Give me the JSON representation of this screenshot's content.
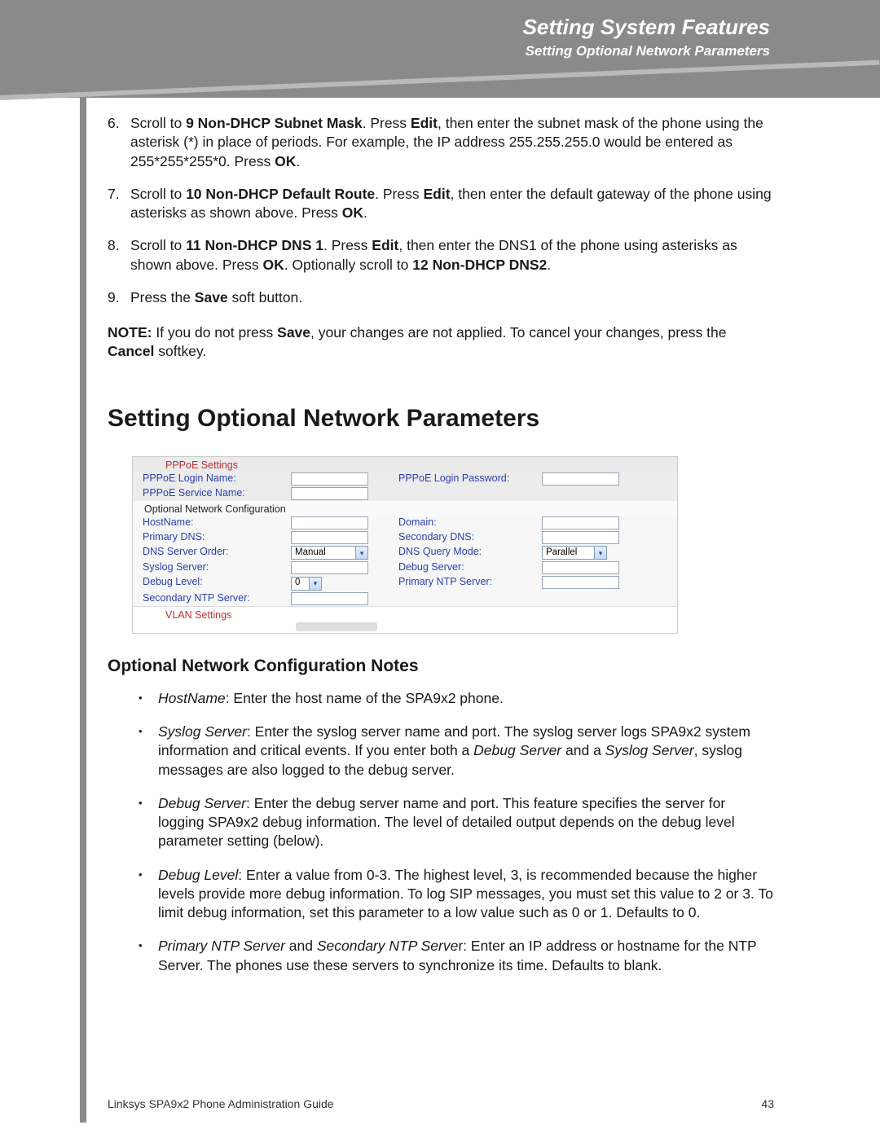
{
  "header": {
    "title": "Setting System Features",
    "subtitle": "Setting Optional Network Parameters"
  },
  "steps": [
    {
      "num": "6.",
      "html": "Scroll to <b>9 Non-DHCP Subnet Mask</b>. Press <b>Edit</b>, then enter the subnet mask of the phone using the asterisk (*) in place of periods. For example, the IP address 255.255.255.0 would be entered as 255*255*255*0. Press <b>OK</b>."
    },
    {
      "num": "7.",
      "html": "Scroll to <b>10 Non-DHCP Default Route</b>. Press <b>Edit</b>, then enter the default gateway of the phone using asterisks as shown above. Press <b>OK</b>."
    },
    {
      "num": "8.",
      "html": "Scroll to <b>11 Non-DHCP DNS 1</b>. Press <b>Edit</b>, then enter the DNS1 of the phone using asterisks as shown above. Press <b>OK</b>. Optionally scroll to <b>12 Non-DHCP DNS2</b>."
    },
    {
      "num": "9.",
      "html": "Press the <b>Save</b> soft button."
    }
  ],
  "note_html": "<b>NOTE:</b> If you do not press <b>Save</b>, your changes are not applied. To cancel your changes, press the <b>Cancel</b> softkey.",
  "section_heading": "Setting Optional Network Parameters",
  "config": {
    "pppoe_title": "PPPoE Settings",
    "pppoe_login_name": "PPPoE Login Name:",
    "pppoe_login_password": "PPPoE Login Password:",
    "pppoe_service_name": "PPPoE Service Name:",
    "opt_title": "Optional Network Configuration",
    "hostname": "HostName:",
    "domain": "Domain:",
    "primary_dns": "Primary DNS:",
    "secondary_dns": "Secondary DNS:",
    "dns_server_order": "DNS Server Order:",
    "dns_server_order_val": "Manual",
    "dns_query_mode": "DNS Query Mode:",
    "dns_query_mode_val": "Parallel",
    "syslog_server": "Syslog Server:",
    "debug_server": "Debug Server:",
    "debug_level": "Debug Level:",
    "debug_level_val": "0",
    "primary_ntp": "Primary NTP Server:",
    "secondary_ntp": "Secondary NTP Server:",
    "vlan": "VLAN Settings"
  },
  "subheading": "Optional Network Configuration Notes",
  "bullets": [
    "<i>HostName</i>: Enter the host name of the SPA9x2 phone.",
    "<i>Syslog Server</i>: Enter the syslog server name and port. The syslog server logs SPA9x2 system information and critical events. If you enter both a <i>Debug Server</i> and a <i>Syslog Server</i>, syslog messages are also logged to the debug server.",
    "<i>Debug Server</i>: Enter the debug server name and port. This feature specifies the server for logging SPA9x2 debug information. The level of detailed output depends on the debug level parameter setting (below).",
    "<i>Debug Level</i>: Enter a value from 0-3. The highest level, 3, is recommended because the higher levels provide more debug information. To log SIP messages, you must set this value to 2 or 3. To limit debug information, set this parameter to a low value such as 0 or 1. Defaults to 0.",
    "<i>Primary NTP Server</i> and <i>Secondary NTP Serve</i>r: Enter an IP address or hostname for the NTP Server. The phones use these servers to synchronize its time. Defaults to blank."
  ],
  "footer": {
    "left": "Linksys SPA9x2 Phone Administration Guide",
    "right": "43"
  }
}
